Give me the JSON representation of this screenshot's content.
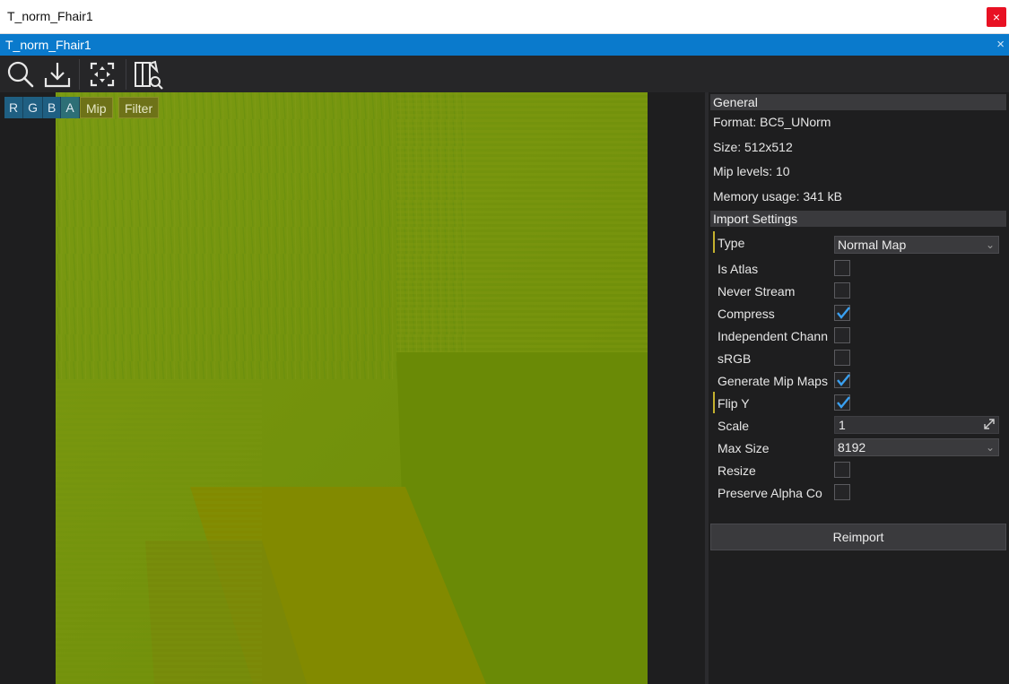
{
  "window": {
    "title": "T_norm_Fhair1",
    "close_glyph": "×"
  },
  "tab": {
    "title": "T_norm_Fhair1",
    "close_glyph": "×"
  },
  "toolbar": {
    "icons": [
      "search-icon",
      "import-icon",
      "center-view-icon",
      "docs-search-icon"
    ]
  },
  "viewport": {
    "channels": [
      "R",
      "G",
      "B",
      "A"
    ],
    "mip_label": "Mip",
    "filter_label": "Filter",
    "texture_color": "#6f8b08"
  },
  "general": {
    "header": "General",
    "format": "Format: BC5_UNorm",
    "size": "Size: 512x512",
    "mip_levels": "Mip levels: 10",
    "memory": "Memory usage: 341 kB"
  },
  "import_settings": {
    "header": "Import Settings",
    "type_label": "Type",
    "type_value": "Normal Map",
    "is_atlas_label": "Is Atlas",
    "is_atlas": false,
    "never_stream_label": "Never Stream",
    "never_stream": false,
    "compress_label": "Compress",
    "compress": true,
    "independent_label": "Independent Chann",
    "independent": false,
    "srgb_label": "sRGB",
    "srgb": false,
    "gen_mips_label": "Generate Mip Maps",
    "gen_mips": true,
    "flip_y_label": "Flip Y",
    "flip_y": true,
    "scale_label": "Scale",
    "scale_value": "1",
    "max_size_label": "Max Size",
    "max_size_value": "8192",
    "resize_label": "Resize",
    "resize": false,
    "preserve_alpha_label": "Preserve Alpha Co",
    "preserve_alpha": false
  },
  "reimport_label": "Reimport",
  "colors": {
    "accent": "#0a7acc",
    "check": "#3aa0f0",
    "marker": "#c4b12e"
  }
}
